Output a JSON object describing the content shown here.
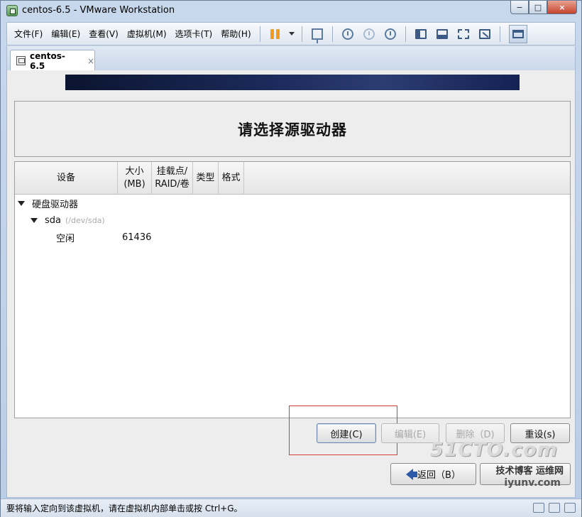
{
  "window": {
    "title": "centos-6.5 - VMware Workstation",
    "buttons": {
      "minimize": "−",
      "maximize": "□",
      "close": "×"
    }
  },
  "menu": [
    {
      "label": "文件(F)"
    },
    {
      "label": "编辑(E)"
    },
    {
      "label": "查看(V)"
    },
    {
      "label": "虚拟机(M)"
    },
    {
      "label": "选项卡(T)"
    },
    {
      "label": "帮助(H)"
    }
  ],
  "toolbar_icons": [
    "pause-icon",
    "dropdown-caret-icon",
    "network-icon",
    "snapshot-icon",
    "revert-snapshot-icon",
    "snapshot-manager-icon",
    "console-view-icon",
    "thumbnail-bar-icon",
    "full-screen-icon",
    "unity-icon",
    "library-view-icon"
  ],
  "tab": {
    "label": "centos-6.5",
    "close": "×"
  },
  "installer": {
    "heading": "请选择源驱动器",
    "columns": [
      {
        "label": "设备"
      },
      {
        "label": "大小\n(MB)"
      },
      {
        "label": "挂载点/\nRAID/卷"
      },
      {
        "label": "类型"
      },
      {
        "label": "格式"
      }
    ],
    "tree": {
      "group_label": "硬盘驱动器",
      "disk_name": "sda",
      "disk_path": "(/dev/sda)",
      "free_label": "空闲",
      "free_size": "61436"
    },
    "actions": {
      "create": "创建(C)",
      "edit": "编辑(E)",
      "delete": "删除（D)",
      "reset": "重设(s)"
    },
    "nav": {
      "back": "返回（B）"
    },
    "watermark": {
      "brand": "51CTO.com",
      "tagline": "技术博客  运维网",
      "site": "iyunv.com"
    }
  },
  "statusbar": {
    "text": "要将输入定向到该虚拟机，请在虚拟机内部单击或按 Ctrl+G。"
  },
  "colors": {
    "highlight_box": "#d43a3a",
    "banner": "#1b2a5a",
    "pause_accent": "#f29b1c"
  }
}
